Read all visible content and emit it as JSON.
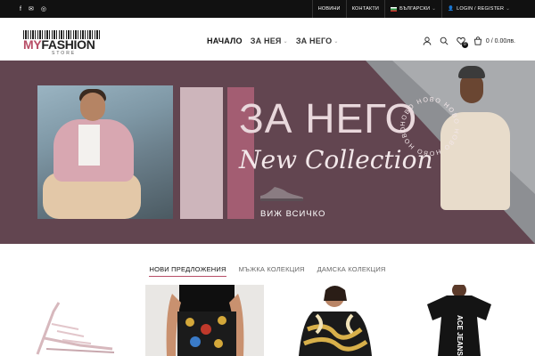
{
  "topbar": {
    "social": [
      {
        "icon": "facebook-icon",
        "glyph": "f"
      },
      {
        "icon": "mail-icon",
        "glyph": "✉"
      },
      {
        "icon": "instagram-icon",
        "glyph": "◎"
      }
    ],
    "news": "НОВИНИ",
    "contacts": "КОНТАКТИ",
    "language": "БЪЛГАРСКИ",
    "login": "LOGIN / REGISTER"
  },
  "logo": {
    "my": "MY",
    "fashion": "FASHION",
    "store": "STORE"
  },
  "nav": {
    "home": "НАЧАЛО",
    "for_her": "ЗА НЕЯ",
    "for_him": "ЗА НЕГО"
  },
  "cart": {
    "count": "0",
    "total": "0 / 0.00лв."
  },
  "hero": {
    "title": "ЗА НЕГО",
    "subtitle": "New Collection",
    "cta": "ВИЖ ВСИЧКО",
    "circle_text": "НОВО НОВО НОВО НОВО НОВО НОВО",
    "colors": {
      "background": "#624550",
      "accent": "#a35d72",
      "light": "#cdb5bb"
    }
  },
  "tabs": {
    "new_offers": "НОВИ ПРЕДЛОЖЕНИЯ",
    "mens": "МЪЖКА КОЛЕКЦИЯ",
    "womens": "ДАМСКА КОЛЕКЦИЯ"
  },
  "products": [
    {
      "icon": "sandal-image"
    },
    {
      "icon": "printed-skirt-image"
    },
    {
      "icon": "baroque-print-shirt-image"
    },
    {
      "icon": "jeans-dress-image",
      "print": "ACE JEANS"
    }
  ]
}
